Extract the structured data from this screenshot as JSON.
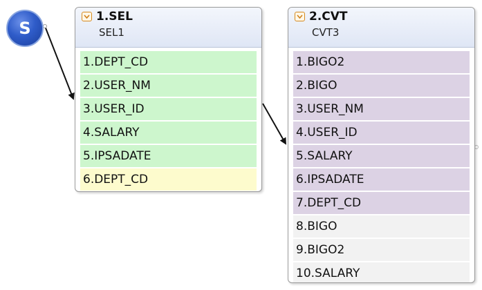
{
  "start": {
    "label": "S"
  },
  "colors": {
    "green_row": "#cdf6cd",
    "yellow_row": "#fdfbcd",
    "purple_row": "#dcd2e4",
    "gray_row": "#f2f2f2",
    "start_node": "#2f5cc9"
  },
  "nodes": [
    {
      "title": "1.SEL",
      "subtitle": "SEL1",
      "rows": [
        {
          "label": "1.DEPT_CD",
          "color": "green"
        },
        {
          "label": "2.USER_NM",
          "color": "green"
        },
        {
          "label": "3.USER_ID",
          "color": "green"
        },
        {
          "label": "4.SALARY",
          "color": "green"
        },
        {
          "label": "5.IPSADATE",
          "color": "green"
        },
        {
          "label": "6.DEPT_CD",
          "color": "yellow"
        }
      ]
    },
    {
      "title": "2.CVT",
      "subtitle": "CVT3",
      "rows": [
        {
          "label": "1.BIGO2",
          "color": "purple"
        },
        {
          "label": "2.BIGO",
          "color": "purple"
        },
        {
          "label": "3.USER_NM",
          "color": "purple"
        },
        {
          "label": "4.USER_ID",
          "color": "purple"
        },
        {
          "label": "5.SALARY",
          "color": "purple"
        },
        {
          "label": "6.IPSADATE",
          "color": "purple"
        },
        {
          "label": "7.DEPT_CD",
          "color": "purple"
        },
        {
          "label": "8.BIGO",
          "color": "gray"
        },
        {
          "label": "9.BIGO2",
          "color": "gray"
        },
        {
          "label": "10.SALARY",
          "color": "gray"
        }
      ]
    }
  ]
}
